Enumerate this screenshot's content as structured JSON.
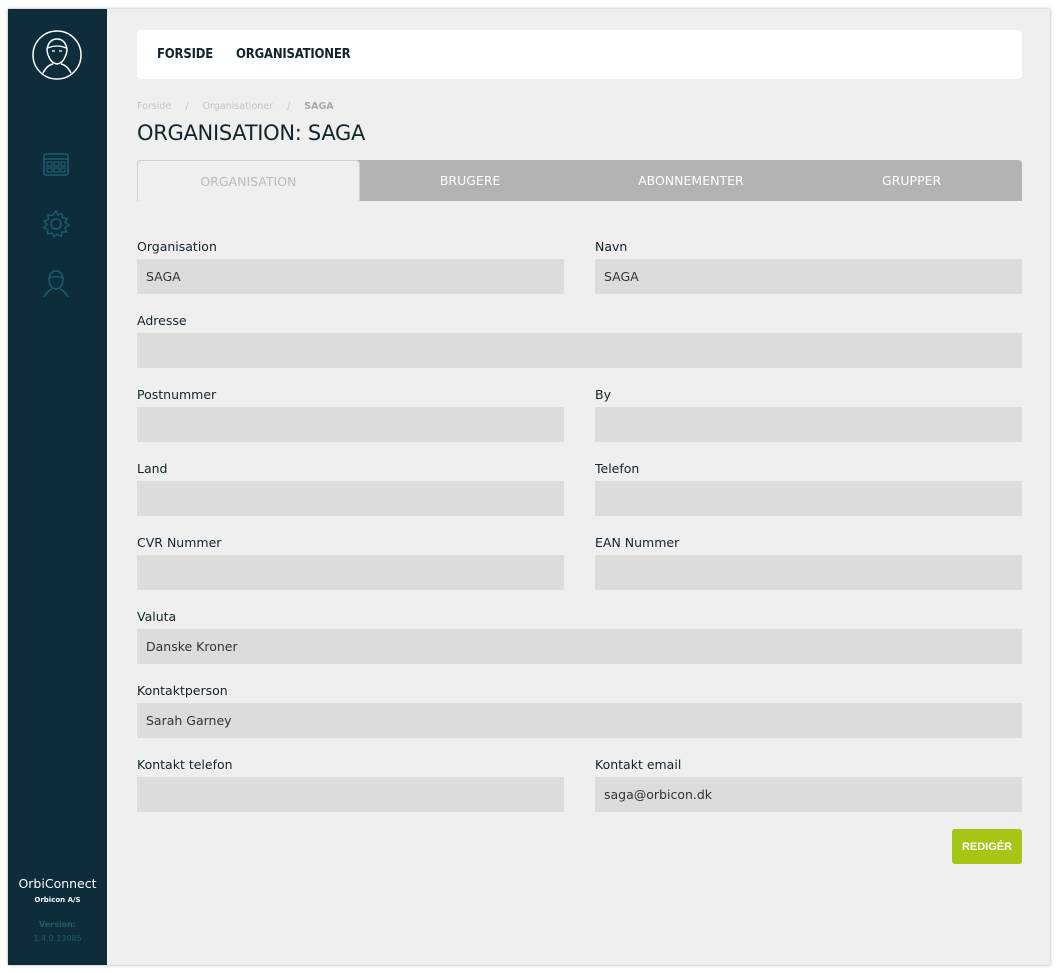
{
  "sidebar": {
    "app_name": "OrbiConnect",
    "company": "Orbicon A/S",
    "version_label": "Version:",
    "version": "1.4.0.13085",
    "icons": [
      "user-avatar-icon",
      "dashboard-icon",
      "gear-icon",
      "user-icon"
    ]
  },
  "topnav": {
    "items": [
      "FORSIDE",
      "ORGANISATIONER"
    ]
  },
  "breadcrumb": {
    "items": [
      "Forside",
      "Organisationer"
    ],
    "separator": "/",
    "current": "SAGA"
  },
  "page": {
    "title": "ORGANISATION: SAGA"
  },
  "tabs": [
    "ORGANISATION",
    "BRUGERE",
    "ABONNEMENTER",
    "GRUPPER"
  ],
  "form": {
    "organisation": {
      "label": "Organisation",
      "value": "SAGA"
    },
    "navn": {
      "label": "Navn",
      "value": "SAGA"
    },
    "adresse": {
      "label": "Adresse",
      "value": ""
    },
    "postnummer": {
      "label": "Postnummer",
      "value": ""
    },
    "by": {
      "label": "By",
      "value": ""
    },
    "land": {
      "label": "Land",
      "value": ""
    },
    "telefon": {
      "label": "Telefon",
      "value": ""
    },
    "cvr": {
      "label": "CVR Nummer",
      "value": ""
    },
    "ean": {
      "label": "EAN Nummer",
      "value": ""
    },
    "valuta": {
      "label": "Valuta",
      "value": "Danske Kroner"
    },
    "kontaktperson": {
      "label": "Kontaktperson",
      "value": "Sarah Garney"
    },
    "kontakt_telefon": {
      "label": "Kontakt telefon",
      "value": ""
    },
    "kontakt_email": {
      "label": "Kontakt email",
      "value": "saga@orbicon.dk"
    }
  },
  "actions": {
    "edit_label": "REDIGÉR"
  },
  "colors": {
    "sidebar": "#0d2d3a",
    "accent": "#a5c615",
    "tab_bar": "#b3b3b3"
  }
}
